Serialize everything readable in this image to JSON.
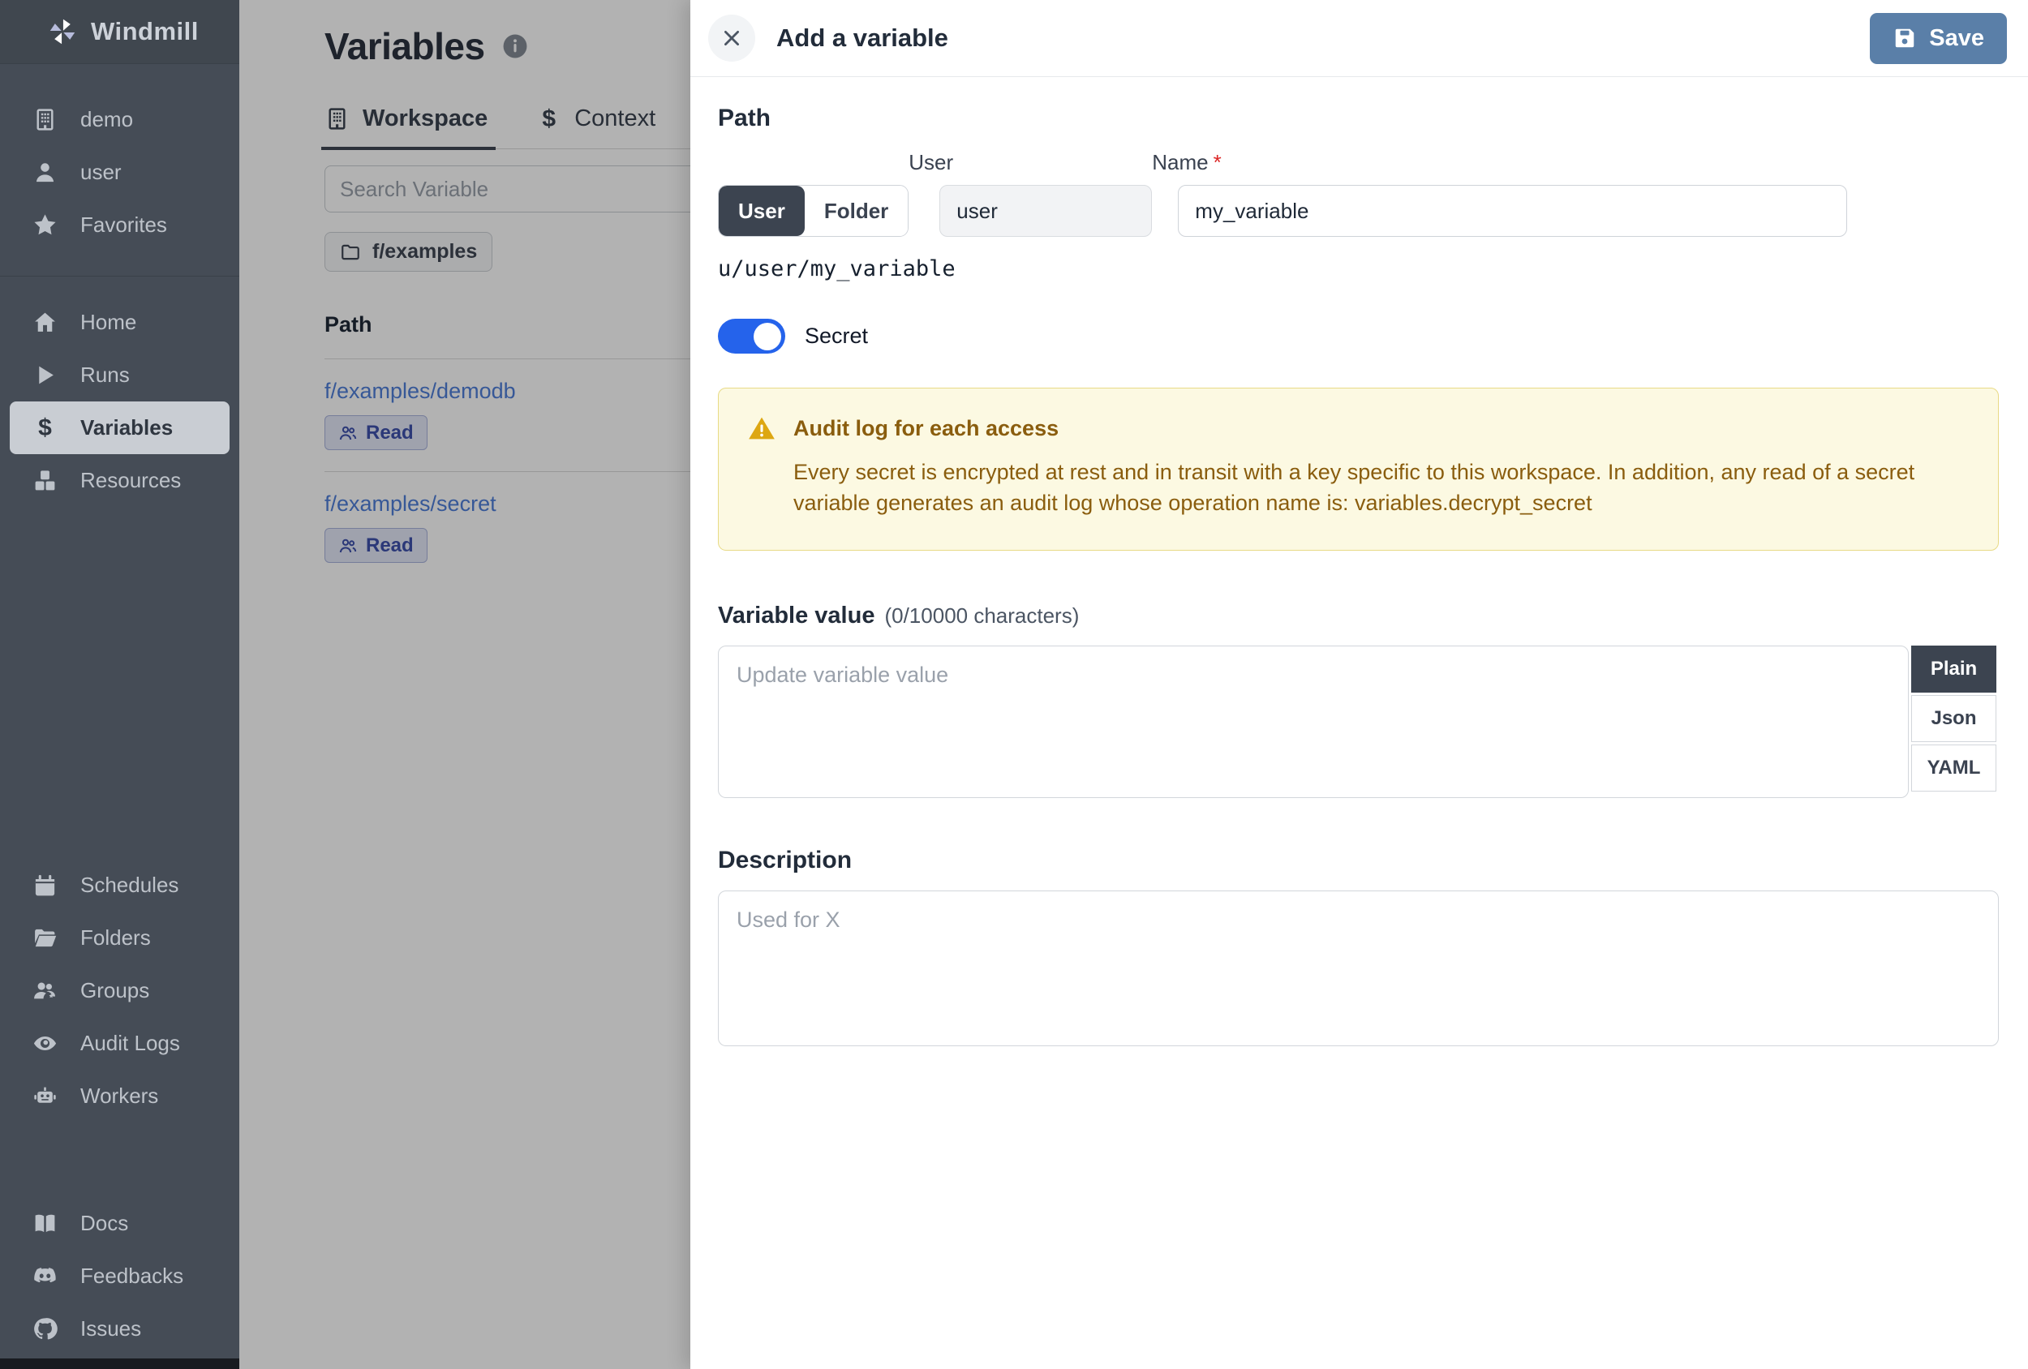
{
  "colors": {
    "sidebar_bg": "#454c56",
    "sidebar_selected_bg": "#c9cdd3",
    "save_button": "#5a7fa8",
    "secret_toggle_on": "#2563eb",
    "warning_bg": "#fcf9e2",
    "warning_text": "#8a5d0e",
    "selected_segment_bg": "#3c4450",
    "link_blue": "#4f7fd8"
  },
  "icons": {
    "windmill-logo-icon": "pinwheel",
    "building-icon": "building with windows",
    "user-icon": "person silhouette",
    "star-icon": "star",
    "home-icon": "house",
    "play-icon": "play triangle",
    "dollar-icon": "$",
    "cubes-icon": "three stacked cubes",
    "calendar-icon": "calendar",
    "folder-open-icon": "open folder",
    "users-gear-icon": "people with gear",
    "eye-icon": "eye",
    "robot-icon": "robot head",
    "book-icon": "open book",
    "discord-icon": "discord logo",
    "github-icon": "github logo",
    "info-icon": "i in circle",
    "close-icon": "x cross",
    "save-icon": "floppy disk",
    "warning-icon": "yellow triangle with exclamation",
    "users-icon": "two people outline",
    "folder-icon": "folder outline"
  },
  "sidebar": {
    "app_name": "Windmill",
    "workspace_items": [
      {
        "icon": "building",
        "label": "demo"
      },
      {
        "icon": "user",
        "label": "user"
      },
      {
        "icon": "star",
        "label": "Favorites"
      }
    ],
    "nav_items": [
      {
        "icon": "home",
        "label": "Home",
        "selected": false
      },
      {
        "icon": "play",
        "label": "Runs",
        "selected": false
      },
      {
        "icon": "dollar",
        "label": "Variables",
        "selected": true
      },
      {
        "icon": "cubes",
        "label": "Resources",
        "selected": false
      }
    ],
    "secondary_items": [
      {
        "icon": "calendar",
        "label": "Schedules"
      },
      {
        "icon": "folder-open",
        "label": "Folders"
      },
      {
        "icon": "users-gear",
        "label": "Groups"
      },
      {
        "icon": "eye",
        "label": "Audit Logs"
      },
      {
        "icon": "robot",
        "label": "Workers"
      }
    ],
    "footer_items": [
      {
        "icon": "book",
        "label": "Docs"
      },
      {
        "icon": "discord",
        "label": "Feedbacks"
      },
      {
        "icon": "github",
        "label": "Issues"
      }
    ]
  },
  "main": {
    "title": "Variables",
    "tabs": [
      {
        "icon": "building",
        "label": "Workspace",
        "selected": true
      },
      {
        "icon": "dollar",
        "label": "Context",
        "selected": false
      }
    ],
    "search_placeholder": "Search Variable",
    "folder_chip": "f/examples",
    "table": {
      "path_header": "Path",
      "rows": [
        {
          "path": "f/examples/demodb",
          "badge": "Read"
        },
        {
          "path": "f/examples/secret",
          "badge": "Read"
        }
      ]
    }
  },
  "drawer": {
    "title": "Add a variable",
    "save_label": "Save",
    "path_section": {
      "heading": "Path",
      "owner_options": [
        {
          "label": "User",
          "selected": true
        },
        {
          "label": "Folder",
          "selected": false
        }
      ],
      "user_label": "User",
      "user_value": "user",
      "name_label": "Name",
      "name_required_mark": "*",
      "name_value": "my_variable",
      "full_path": "u/user/my_variable"
    },
    "secret_toggle": {
      "label": "Secret",
      "on": true
    },
    "warning": {
      "title": "Audit log for each access",
      "body": "Every secret is encrypted at rest and in transit with a key specific to this workspace. In addition, any read of a secret variable generates an audit log whose operation name is: variables.decrypt_secret"
    },
    "value_section": {
      "heading": "Variable value",
      "counter": "(0/10000 characters)",
      "placeholder": "Update variable value",
      "format_tabs": [
        {
          "label": "Plain",
          "selected": true
        },
        {
          "label": "Json",
          "selected": false
        },
        {
          "label": "YAML",
          "selected": false
        }
      ]
    },
    "description_section": {
      "heading": "Description",
      "placeholder": "Used for X"
    }
  }
}
